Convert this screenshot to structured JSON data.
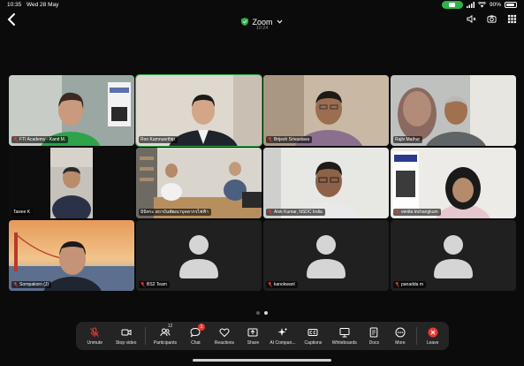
{
  "status": {
    "time": "10:35",
    "date": "Wed 28 May",
    "battery": "90%"
  },
  "header": {
    "title": "Zoom",
    "timer": "10:24",
    "shield_color": "#2fb34a"
  },
  "participants": [
    {
      "name": "FTI Academy - Kanit M.",
      "muted": true,
      "video": true,
      "active": false
    },
    {
      "name": "Ron Kamnuerthip",
      "muted": false,
      "video": true,
      "active": true
    },
    {
      "name": "Brijesh Srivastava",
      "muted": true,
      "video": true,
      "active": false
    },
    {
      "name": "Rajiv Mathur",
      "muted": false,
      "video": true,
      "active": false
    },
    {
      "name": "Tawee K",
      "muted": false,
      "video": true,
      "active": false
    },
    {
      "name": "มินิทระ สถาบันพัฒนาบุคลากรไฟฟ้า",
      "muted": false,
      "video": true,
      "active": false
    },
    {
      "name": "Alok Kumar, NSDC India",
      "muted": true,
      "video": true,
      "active": false
    },
    {
      "name": "venita inchangkum",
      "muted": true,
      "video": true,
      "active": false
    },
    {
      "name": "Sornpakorn (J)",
      "muted": true,
      "video": true,
      "active": false
    },
    {
      "name": "BS2 Team",
      "muted": true,
      "video": false,
      "active": false
    },
    {
      "name": "kanokwanl",
      "muted": true,
      "video": false,
      "active": false
    },
    {
      "name": "panadda m",
      "muted": true,
      "video": false,
      "active": false
    }
  ],
  "toolbar": {
    "unmute": "Unmute",
    "stop_video": "Stop video",
    "participants": "Participants",
    "participants_count": "12",
    "chat": "Chat",
    "chat_badge": "1",
    "reactions": "Reactions",
    "share": "Share",
    "ai_companion": "AI Compan...",
    "captions": "Captions",
    "whiteboards": "Whiteboards",
    "docs": "Docs",
    "more": "More",
    "leave": "Leave"
  },
  "colors": {
    "accent": "#2fb34a",
    "muted_icon": "#e53b33",
    "leave": "#e53b33"
  },
  "pager": {
    "pages": 2,
    "current": 2
  }
}
